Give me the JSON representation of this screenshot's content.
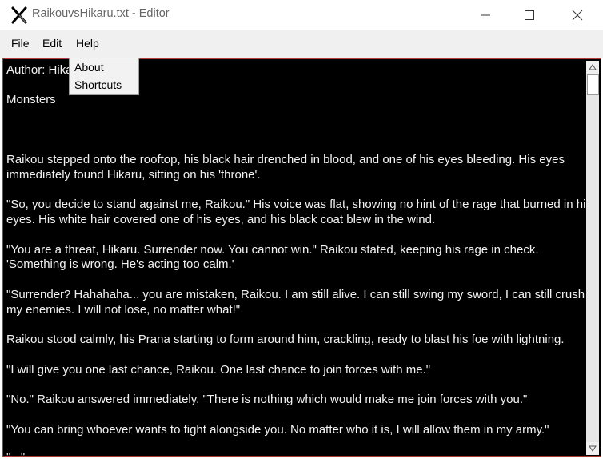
{
  "window": {
    "title": "RaikouvsHikaru.txt - Editor",
    "icon": "x-app-icon"
  },
  "menu": {
    "file": "File",
    "edit": "Edit",
    "help": "Help"
  },
  "help_menu": {
    "about": "About",
    "shortcuts": "Shortcuts"
  },
  "editor": {
    "lines": [
      "Author: Hikaru",
      "Monsters",
      "",
      "",
      "Raikou stepped onto the rooftop, his black hair drenched in blood, and one of his eyes bleeding. His eyes",
      "immediately found Hikaru, sitting on his 'throne'.",
      "\"So, you decide to stand against me, Raikou.\" His voice was flat, showing no hint of the rage that burned in his",
      "eyes. His white hair covered one of his eyes, and his black coat blew in the wind.",
      "\"You are a threat, Hikaru. Surrender now. You cannot win.\" Raikou stated, keeping his rage in check.",
      "'Something is wrong. He's acting too calm.'",
      "\"Surrender? Hahahaha... you are mistaken, Raikou. I am still alive. I can still swing my sword, I can still crush",
      "my enemies. I will not lose, no matter what!\"",
      "Raikou stood calmly, his Prana starting to form around him, crackling, ready to blast his foe with lightning.",
      "\"I will give you one last chance, Raikou. One last chance to join forces with me.\"",
      "\"No.\" Raikou answered immediately. \"There is nothing which would make me join forces with you.\"",
      "\"You can bring whoever wants to fight alongside you. No matter who it is, I will allow them in my army.\"",
      "\"...\""
    ]
  },
  "colors": {
    "editor_bg": "#000000",
    "editor_text": "#f2f2f2",
    "editor_border": "#b03a3a",
    "menubar_bg": "#f0f0f0"
  }
}
